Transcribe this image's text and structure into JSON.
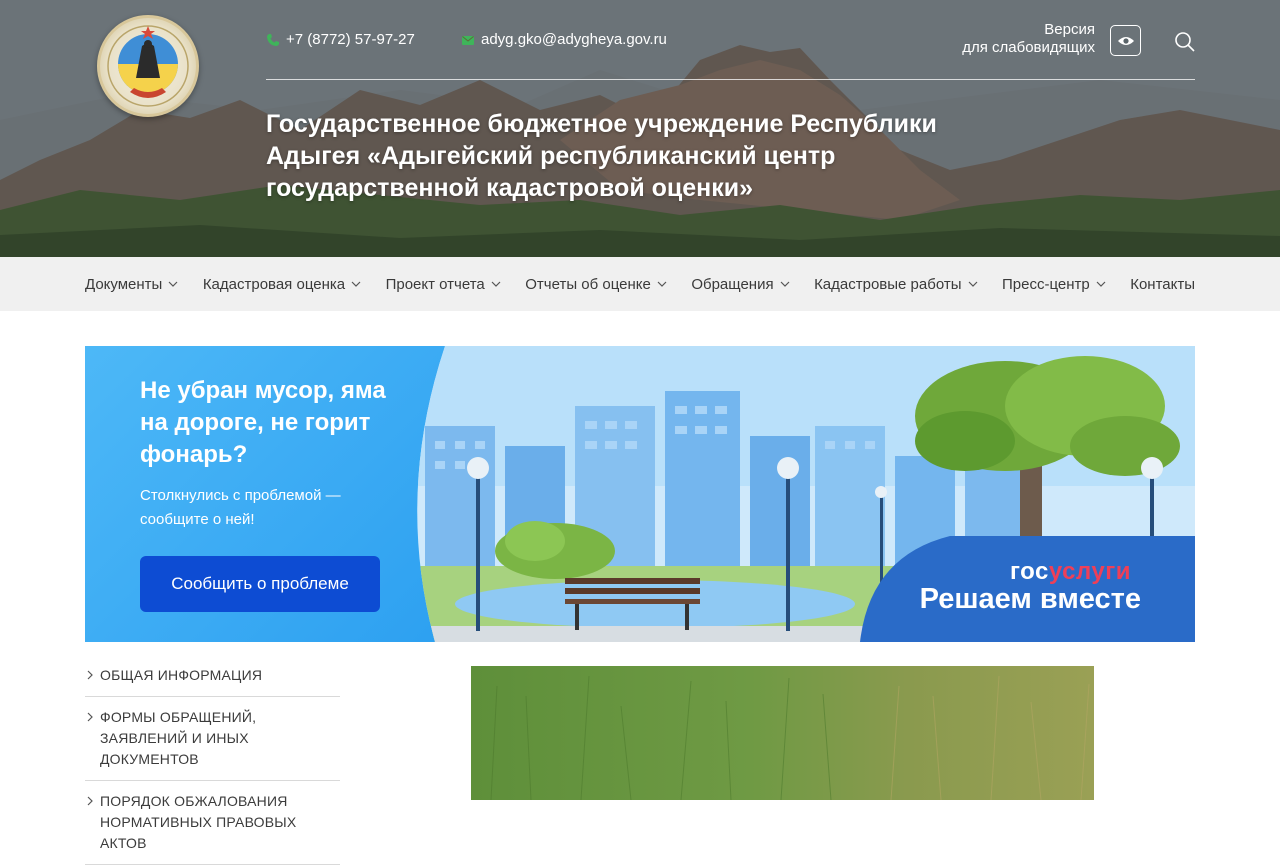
{
  "header": {
    "phone": "+7 (8772) 57-97-27",
    "email": "adyg.gko@adygheya.gov.ru",
    "visually_impaired_label_line1": "Версия",
    "visually_impaired_label_line2": "для слабовидящих",
    "org_title": "Государственное бюджетное учреждение Республики Адыгея «Адыгейский республиканский центр государственной кадастровой оценки»",
    "icons": {
      "phone": "phone-icon",
      "email": "mail-icon",
      "eye": "eye-icon",
      "search": "search-icon"
    },
    "accent_green": "#3fb45a"
  },
  "nav": {
    "items": [
      {
        "label": "Документы"
      },
      {
        "label": "Кадастровая оценка"
      },
      {
        "label": "Проект отчета"
      },
      {
        "label": "Отчеты об оценке"
      },
      {
        "label": "Обращения"
      },
      {
        "label": "Кадастровые работы"
      },
      {
        "label": "Пресс-центр"
      },
      {
        "label": "Контакты"
      }
    ]
  },
  "banner": {
    "headline": "Не убран мусор, яма на дороге, не горит фонарь?",
    "subtext": "Столкнулись с проблемой — сообщите о ней!",
    "button_label": "Сообщить о проблеме",
    "brand_part1": "гос",
    "brand_part2": "услуги",
    "slogan": "Решаем вместе",
    "colors": {
      "button": "#0d4cd3",
      "brand_red": "#ee3f58",
      "panel": "#2a6bc8"
    }
  },
  "sidebar": {
    "items": [
      {
        "label": "Общая информация"
      },
      {
        "label": "Формы обращений, заявлений и иных документов"
      },
      {
        "label": "Порядок обжалования нормативных правовых актов"
      }
    ]
  }
}
